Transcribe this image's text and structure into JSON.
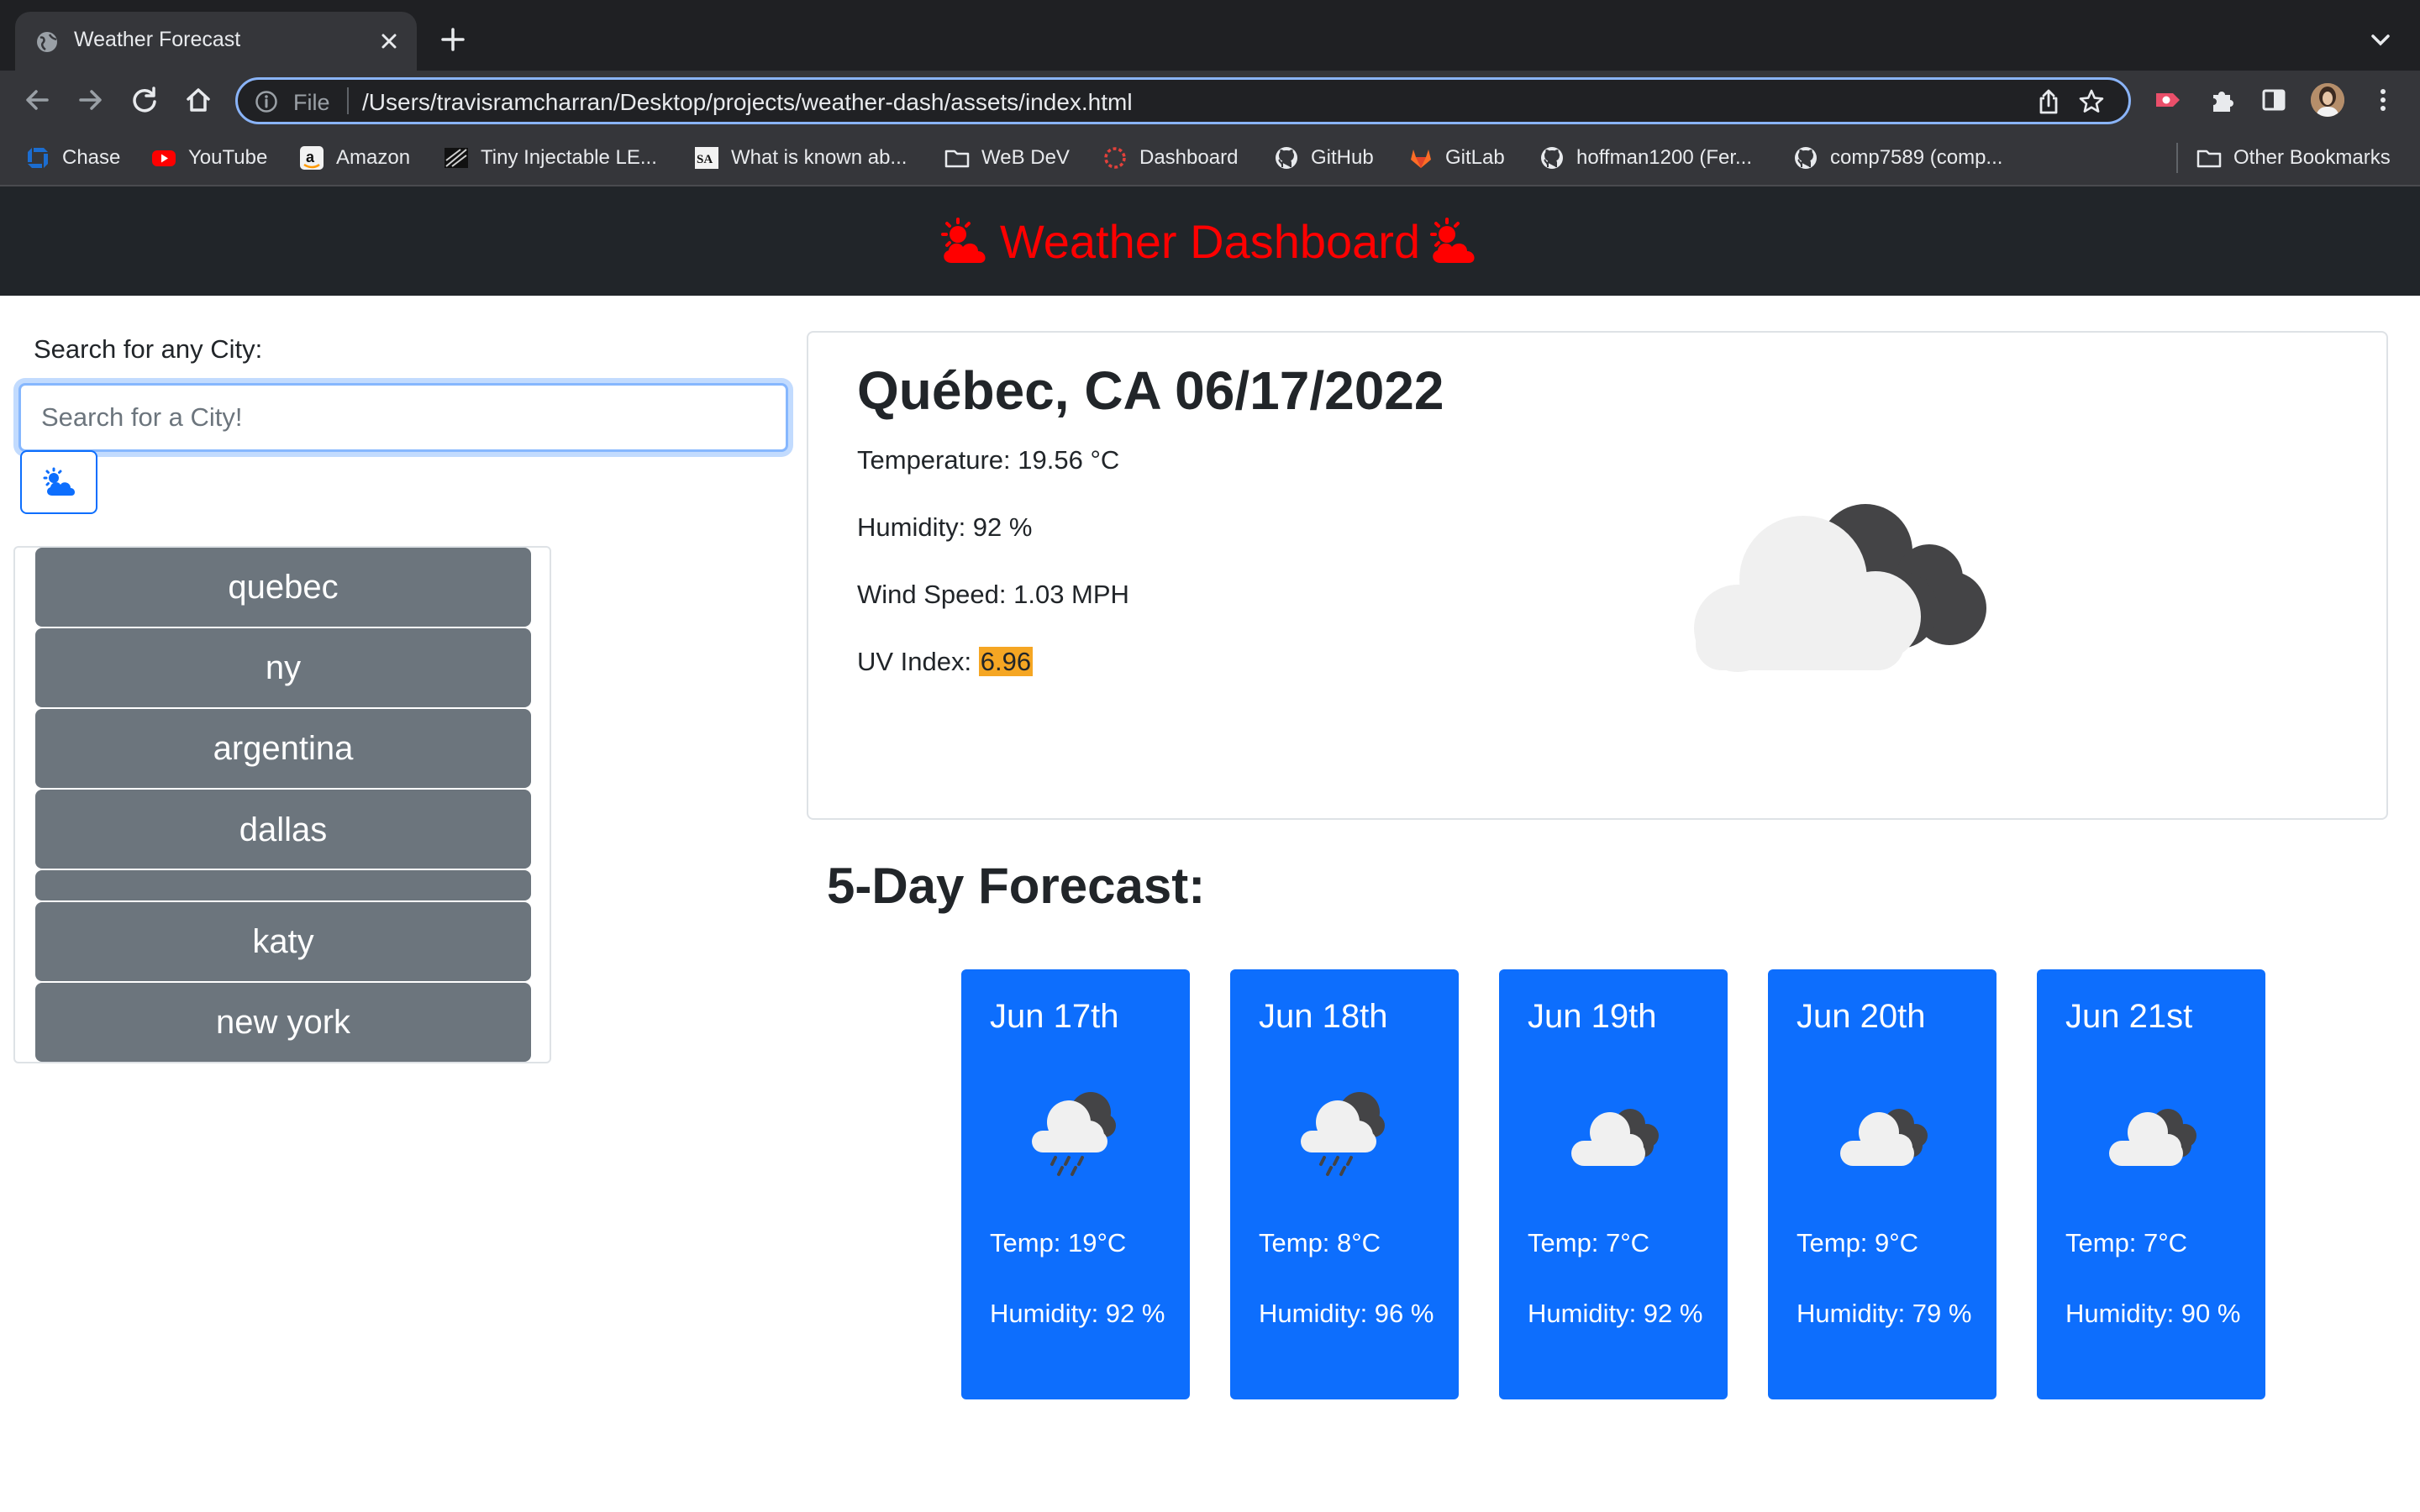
{
  "browser": {
    "tab_title": "Weather Forecast",
    "address_scheme": "File",
    "address_url": "/Users/travisramcharran/Desktop/projects/weather-dash/assets/index.html"
  },
  "bookmarks": [
    {
      "label": "Chase",
      "icon": "chase-icon"
    },
    {
      "label": "YouTube",
      "icon": "youtube-icon"
    },
    {
      "label": "Amazon",
      "icon": "amazon-icon"
    },
    {
      "label": "Tiny Injectable LE...",
      "icon": "site-icon"
    },
    {
      "label": "What is known ab...",
      "icon": "sa-icon"
    },
    {
      "label": "WeB DeV",
      "icon": "folder-icon"
    },
    {
      "label": "Dashboard",
      "icon": "dashboard-icon"
    },
    {
      "label": "GitHub",
      "icon": "github-icon"
    },
    {
      "label": "GitLab",
      "icon": "gitlab-icon"
    },
    {
      "label": "hoffman1200 (Fer...",
      "icon": "github-icon"
    },
    {
      "label": "comp7589 (comp...",
      "icon": "github-icon"
    }
  ],
  "other_bookmarks": "Other Bookmarks",
  "header": {
    "title": "Weather Dashboard",
    "icon": "sun-cloud-icon",
    "title_color": "#ff0000"
  },
  "search": {
    "label": "Search for any City:",
    "placeholder": "Search for a City!",
    "value": "",
    "button_icon": "cloud-sun-icon"
  },
  "history": [
    "quebec",
    "ny",
    "argentina",
    "dallas",
    "katy",
    "new york"
  ],
  "current": {
    "title": "Québec, CA 06/17/2022",
    "temperature": "Temperature: 19.56 °C",
    "humidity": "Humidity: 92 %",
    "wind": "Wind Speed: 1.03 MPH",
    "uv_label": "UV Index: ",
    "uv_value": "6.96",
    "uv_color": "#f5a623",
    "icon": "broken-clouds-icon"
  },
  "forecast": {
    "title": "5-Day Forecast:",
    "days": [
      {
        "date": "Jun 17th",
        "temp": "Temp: 19°C",
        "humidity": "Humidity: 92 %",
        "icon": "rain-cloud-icon"
      },
      {
        "date": "Jun 18th",
        "temp": "Temp: 8°C",
        "humidity": "Humidity: 96 %",
        "icon": "rain-cloud-icon"
      },
      {
        "date": "Jun 19th",
        "temp": "Temp: 7°C",
        "humidity": "Humidity: 92 %",
        "icon": "broken-clouds-icon"
      },
      {
        "date": "Jun 20th",
        "temp": "Temp: 9°C",
        "humidity": "Humidity: 79 %",
        "icon": "broken-clouds-icon"
      },
      {
        "date": "Jun 21st",
        "temp": "Temp: 7°C",
        "humidity": "Humidity: 90 %",
        "icon": "broken-clouds-icon"
      }
    ],
    "card_color": "#0d6efd"
  }
}
